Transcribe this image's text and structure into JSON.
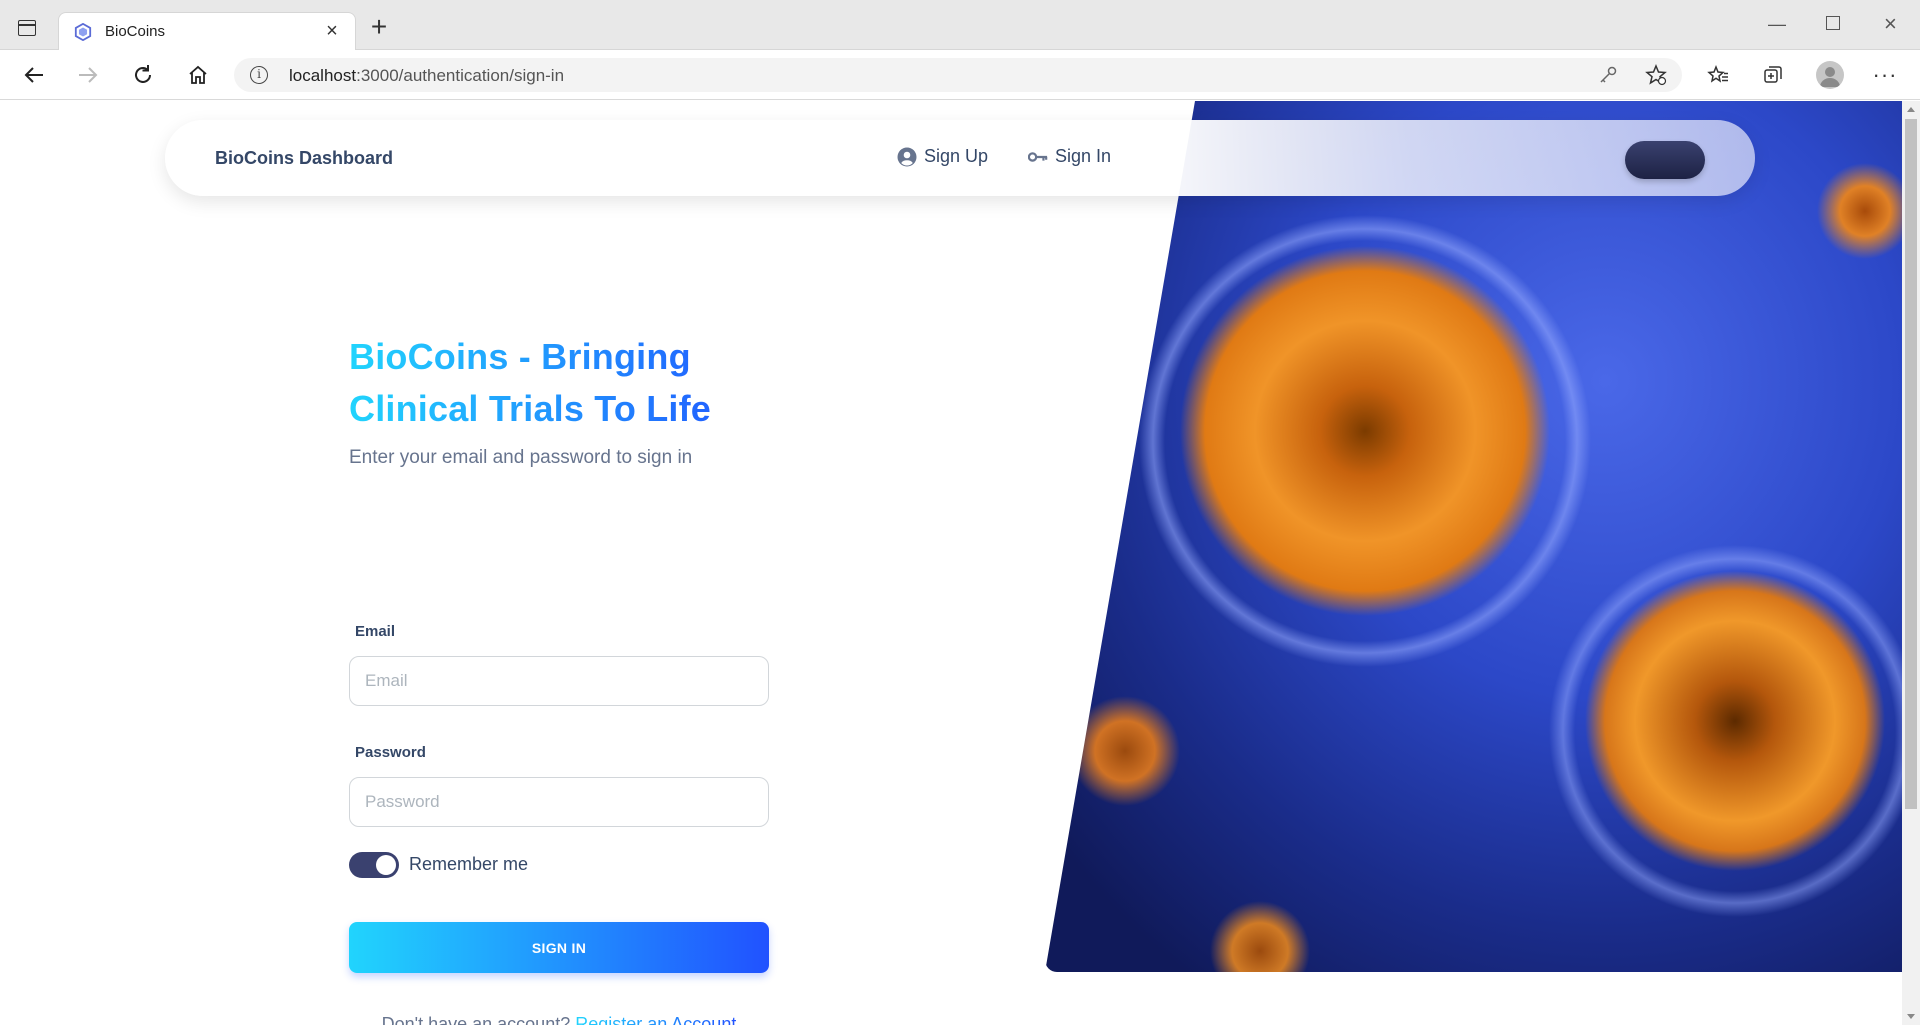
{
  "browser": {
    "tab_title": "BioCoins",
    "url_host": "localhost",
    "url_path": ":3000/authentication/sign-in"
  },
  "navbar": {
    "brand": "BioCoins Dashboard",
    "links": [
      {
        "label": "Sign Up",
        "icon": "user-circle-icon"
      },
      {
        "label": "Sign In",
        "icon": "key-icon"
      }
    ]
  },
  "form": {
    "headline_line1": "BioCoins - Bringing",
    "headline_line2": "Clinical Trials To Life",
    "subtitle": "Enter your email and password to sign in",
    "email_label": "Email",
    "email_placeholder": "Email",
    "password_label": "Password",
    "password_placeholder": "Password",
    "remember_label": "Remember me",
    "remember_on": true,
    "submit_label": "SIGN IN",
    "register_prompt": "Don't have an account?",
    "register_link": "Register an Account"
  },
  "colors": {
    "accent_gradient_start": "#21d4fd",
    "accent_gradient_end": "#2152ff",
    "text_dark": "#344767",
    "text_muted": "#67748e",
    "toggle_on": "#3a416f"
  }
}
